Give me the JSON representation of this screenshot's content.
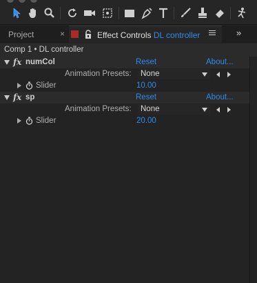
{
  "toolbar": {
    "icons": [
      "selection-tool-icon",
      "hand-tool-icon",
      "zoom-tool-icon",
      "rotation-tool-icon",
      "camera-tool-icon",
      "pan-behind-tool-icon",
      "rectangle-tool-icon",
      "pen-tool-icon",
      "type-tool-icon",
      "brush-tool-icon",
      "clone-stamp-tool-icon",
      "eraser-tool-icon",
      "puppet-tool-icon"
    ]
  },
  "tabs": {
    "project_label": "Project",
    "project_close": "×",
    "effect_controls_prefix": "Effect Controls",
    "effect_controls_layer": "DL controller",
    "more": "»"
  },
  "breadcrumb": "Comp 1 • DL controller",
  "effects": [
    {
      "fx": "fx",
      "name": "numCol",
      "reset": "Reset",
      "about": "About...",
      "presets_label": "Animation Presets:",
      "presets_value": "None",
      "param_label": "Slider",
      "param_value": "10.00"
    },
    {
      "fx": "fx",
      "name": "sp",
      "reset": "Reset",
      "about": "About...",
      "presets_label": "Animation Presets:",
      "presets_value": "None",
      "param_label": "Slider",
      "param_value": "20.00"
    }
  ],
  "colors": {
    "accent_blue": "#2d8ceb",
    "layer_label_red": "#a62b2b",
    "panel_bg": "#232323"
  }
}
